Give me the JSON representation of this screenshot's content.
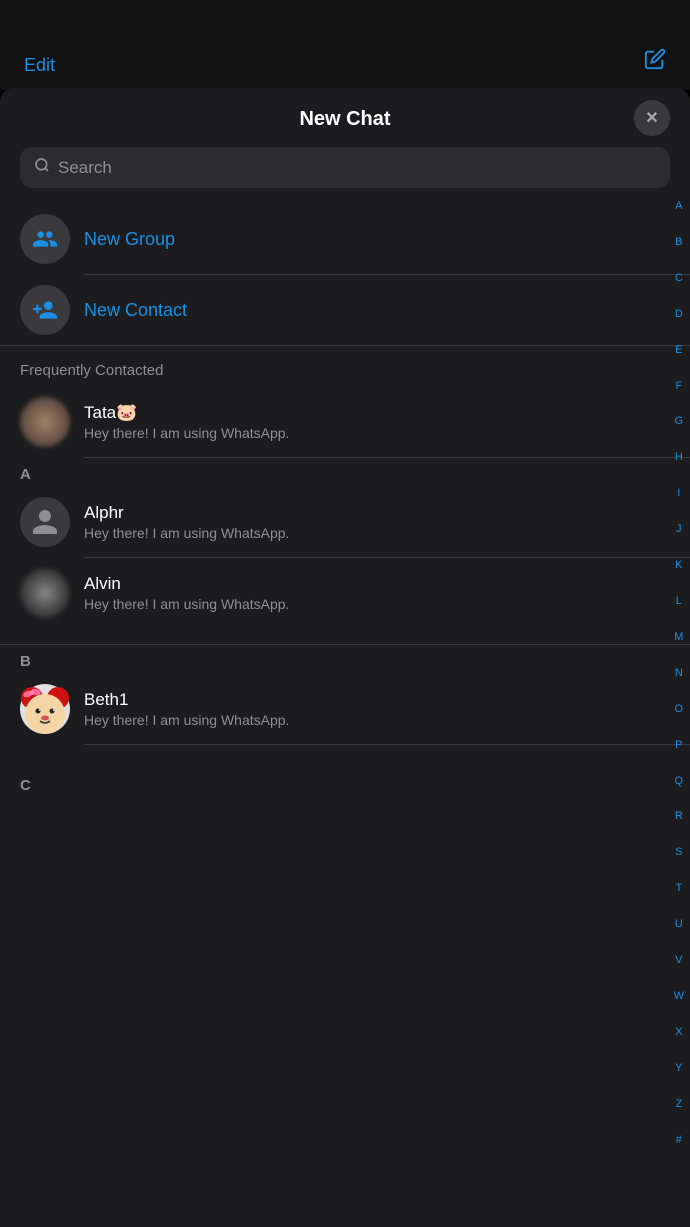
{
  "topBar": {
    "editLabel": "Edit",
    "composeIcon": "compose-icon"
  },
  "modal": {
    "title": "New Chat",
    "closeLabel": "×",
    "search": {
      "placeholder": "Search"
    },
    "actions": [
      {
        "id": "new-group",
        "label": "New Group",
        "icon": "group-icon"
      },
      {
        "id": "new-contact",
        "label": "New Contact",
        "icon": "add-contact-icon"
      }
    ],
    "frequentlyContacted": {
      "sectionLabel": "Frequently Contacted",
      "contacts": [
        {
          "name": "Tata🐷",
          "status": "Hey there! I am using WhatsApp.",
          "avatarType": "tata"
        }
      ]
    },
    "sections": [
      {
        "letter": "A",
        "contacts": [
          {
            "name": "Alphr",
            "status": "Hey there! I am using WhatsApp.",
            "avatarType": "default"
          },
          {
            "name": "Alvin",
            "status": "Hey there! I am using WhatsApp.",
            "avatarType": "alvin"
          }
        ]
      },
      {
        "letter": "B",
        "contacts": [
          {
            "name": "Beth1",
            "status": "Hey there! I am using WhatsApp.",
            "avatarType": "minnie"
          }
        ]
      },
      {
        "letter": "C",
        "contacts": []
      }
    ],
    "alphaIndex": [
      "A",
      "B",
      "C",
      "D",
      "E",
      "F",
      "G",
      "H",
      "I",
      "J",
      "K",
      "L",
      "M",
      "N",
      "O",
      "P",
      "Q",
      "R",
      "S",
      "T",
      "U",
      "V",
      "W",
      "X",
      "Y",
      "Z",
      "#"
    ]
  }
}
